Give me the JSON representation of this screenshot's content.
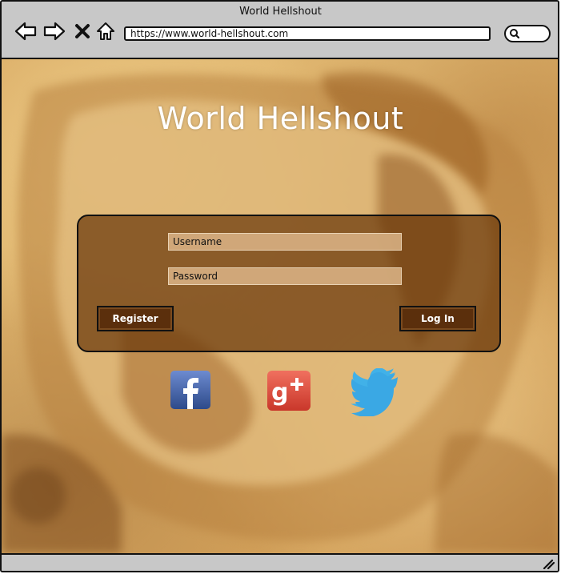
{
  "window": {
    "title": "World Hellshout",
    "url": "https://www.world-hellshout.com"
  },
  "icons": [
    "back-arrow-icon",
    "forward-arrow-icon",
    "close-x-icon",
    "home-icon",
    "search-icon",
    "resize-grip-icon",
    "facebook-icon",
    "google-plus-icon",
    "twitter-icon"
  ],
  "page": {
    "title": "World Hellshout"
  },
  "login": {
    "username_placeholder": "Username",
    "password_placeholder": "Password",
    "register_label": "Register",
    "login_label": "Log In"
  },
  "colors": {
    "panel": "#69370a",
    "button": "#5b2f0c",
    "facebook": "#3b5998",
    "google_plus": "#dd4b39",
    "twitter": "#1da1f2"
  }
}
